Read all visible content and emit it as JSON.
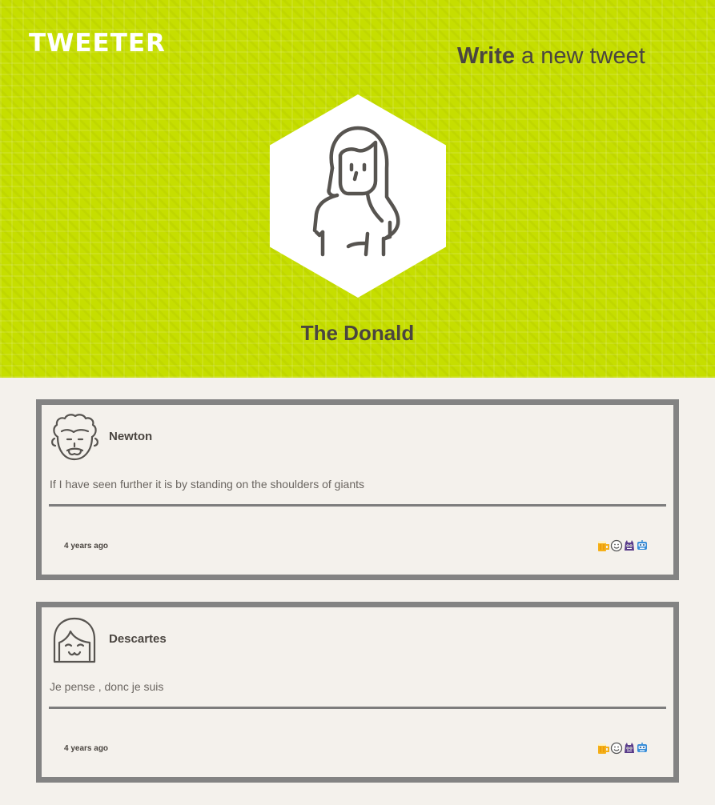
{
  "app": {
    "logo": "TWEETER"
  },
  "compose": {
    "strong": "Write",
    "light": " a new tweet"
  },
  "profile": {
    "name": "The Donald",
    "avatar_icon": "woman-avatar-icon"
  },
  "tweets": [
    {
      "author": "Newton",
      "avatar_icon": "curly-hair-man-avatar-icon",
      "text": "If I have seen further it is by standing on the shoulders of giants",
      "time": "4 years ago",
      "actions": [
        "beer-icon",
        "smiley-icon",
        "monster-icon",
        "robot-icon"
      ]
    },
    {
      "author": "Descartes",
      "avatar_icon": "bob-hair-avatar-icon",
      "text": "Je pense , donc je suis",
      "time": "4 years ago",
      "actions": [
        "beer-icon",
        "smiley-icon",
        "monster-icon",
        "robot-icon"
      ]
    }
  ],
  "colors": {
    "header_bg": "#c6de00",
    "page_bg": "#f4f1ec",
    "card_border": "#838383",
    "text_dark": "#4a4540"
  }
}
